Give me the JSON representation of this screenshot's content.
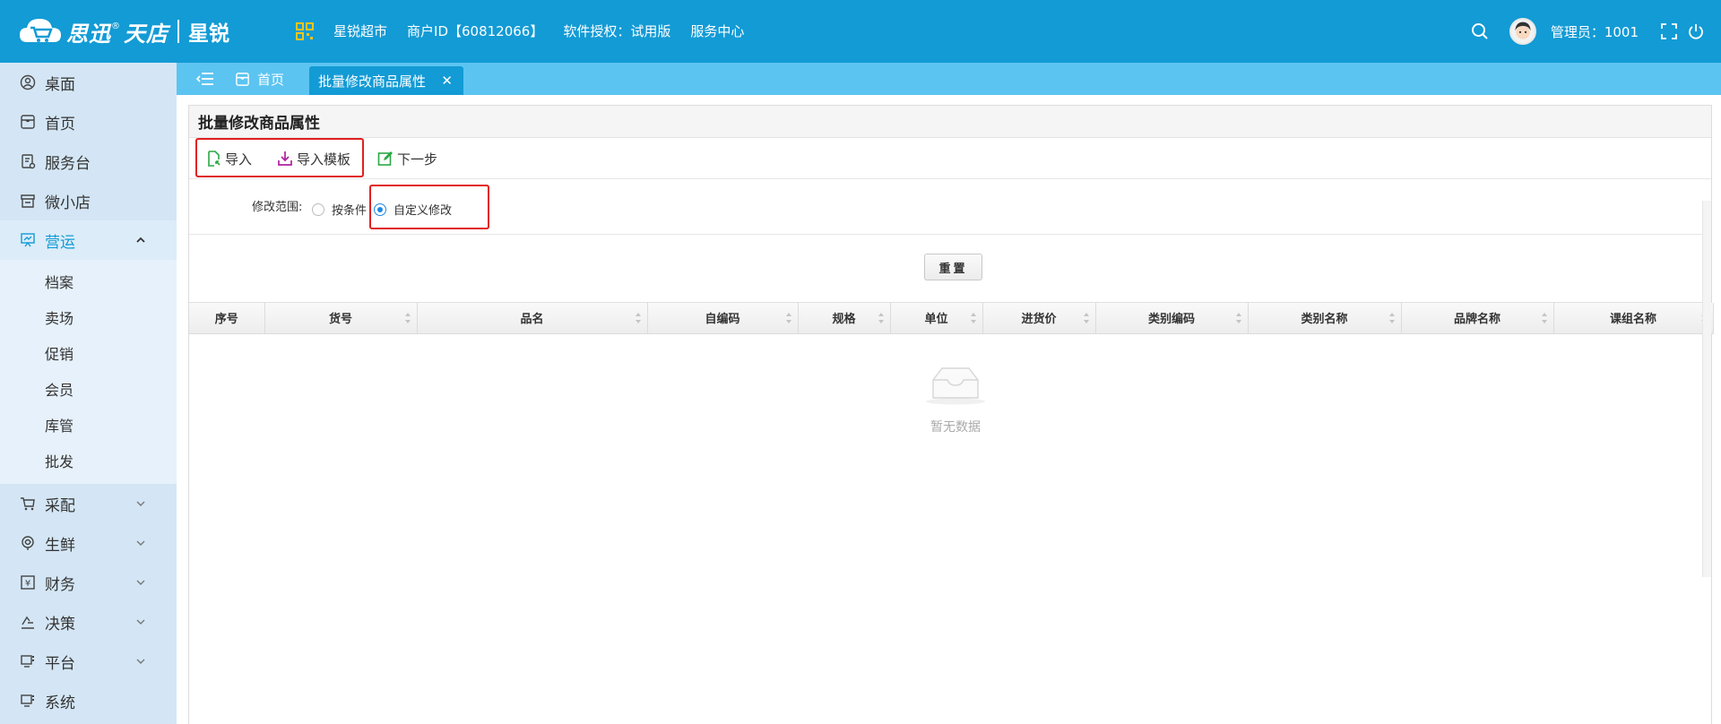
{
  "header": {
    "brand_name": "思迅",
    "brand_reg": "®",
    "brand_name2": "天店",
    "brand_sub": "星锐",
    "nav": [
      "星锐超市",
      "商户ID【60812066】",
      "软件授权：试用版",
      "服务中心"
    ],
    "admin": "管理员：1001"
  },
  "sidebar": {
    "items": [
      {
        "label": "桌面",
        "icon": "user-circle-icon"
      },
      {
        "label": "首页",
        "icon": "home-icon"
      },
      {
        "label": "服务台",
        "icon": "service-desk-icon"
      },
      {
        "label": "微小店",
        "icon": "store-icon"
      },
      {
        "label": "营运",
        "icon": "operations-icon",
        "expanded": true
      }
    ],
    "sub_items": [
      "档案",
      "卖场",
      "促销",
      "会员",
      "库管",
      "批发"
    ],
    "more_items": [
      {
        "label": "采配",
        "icon": "cart-icon"
      },
      {
        "label": "生鲜",
        "icon": "fresh-icon"
      },
      {
        "label": "财务",
        "icon": "finance-icon"
      },
      {
        "label": "决策",
        "icon": "decision-icon"
      },
      {
        "label": "平台",
        "icon": "platform-icon"
      },
      {
        "label": "系统",
        "icon": "system-icon"
      }
    ]
  },
  "tabs": {
    "home": "首页",
    "active": "批量修改商品属性",
    "close": "✕"
  },
  "panel": {
    "title": "批量修改商品属性",
    "toolbar": {
      "import": "导入",
      "import_template": "导入模板",
      "next": "下一步"
    },
    "filter": {
      "label": "修改范围:",
      "options": [
        "按条件",
        "自定义修改"
      ],
      "selected": "自定义修改"
    },
    "reset": "重置",
    "columns": [
      "序号",
      "货号",
      "品名",
      "自编码",
      "规格",
      "单位",
      "进货价",
      "类别编码",
      "类别名称",
      "品牌名称",
      "课组名称"
    ],
    "empty_text": "暂无数据"
  },
  "colors": {
    "header_bg": "#139bd5",
    "tabs_bg": "#5cc4f1",
    "sidebar_bg": "#d4e6f5",
    "highlight": "#e02020"
  }
}
